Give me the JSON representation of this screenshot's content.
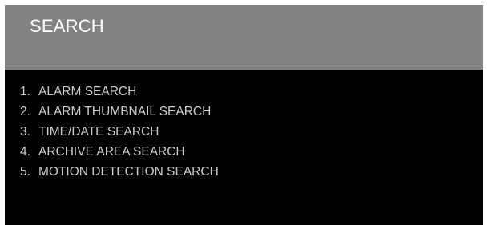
{
  "header": {
    "title": "SEARCH"
  },
  "menu": {
    "items": [
      {
        "number": "1.",
        "label": "ALARM SEARCH"
      },
      {
        "number": "2.",
        "label": "ALARM THUMBNAIL SEARCH"
      },
      {
        "number": "3.",
        "label": "TIME/DATE SEARCH"
      },
      {
        "number": "4.",
        "label": "ARCHIVE AREA SEARCH"
      },
      {
        "number": "5.",
        "label": "MOTION DETECTION SEARCH"
      }
    ]
  },
  "colors": {
    "header_bg": "#828282",
    "body_bg": "#000000",
    "title_text": "#ffffff",
    "menu_text": "#cccccc"
  }
}
